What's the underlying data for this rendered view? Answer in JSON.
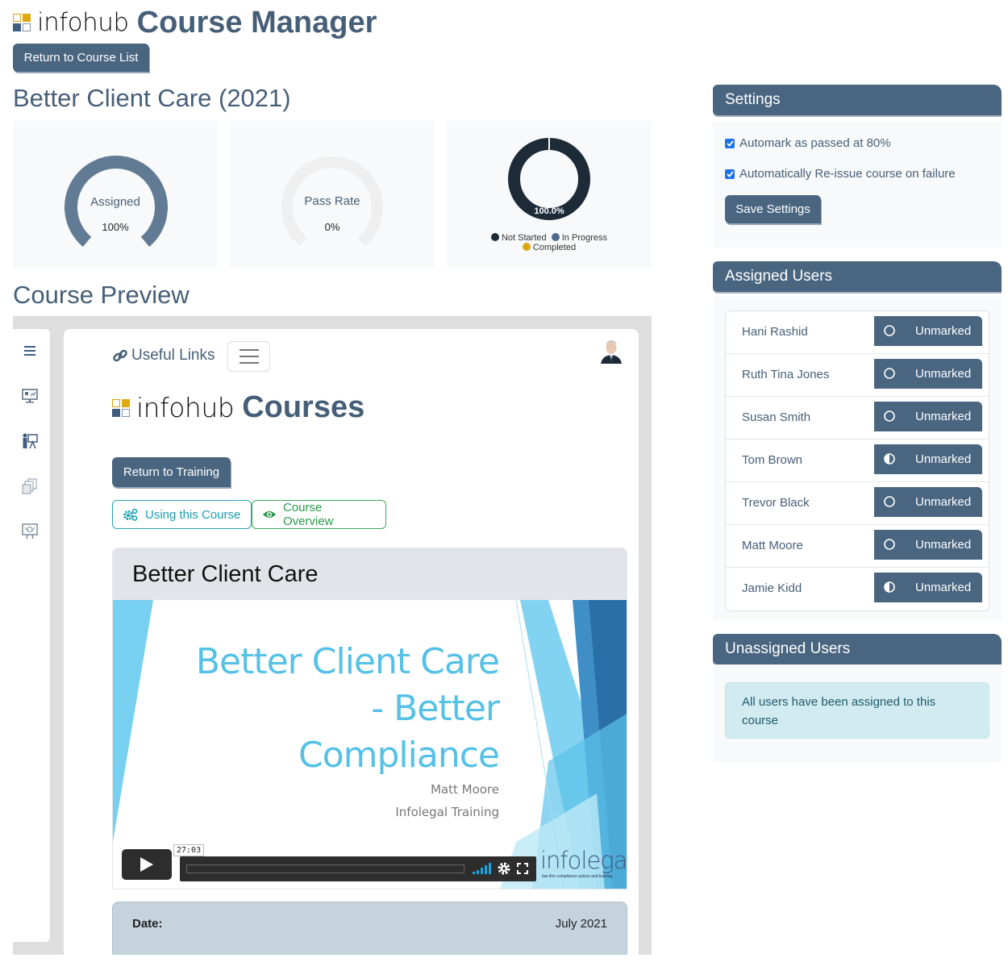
{
  "header": {
    "logo_text_light": "info",
    "logo_text_hub": "hub",
    "title": "Course Manager",
    "return_button": "Return to Course List"
  },
  "course": {
    "title": "Better Client Care (2021)"
  },
  "stats": {
    "assigned": {
      "label": "Assigned",
      "value": "100%",
      "fraction": 1.0,
      "color": "#627b94"
    },
    "pass_rate": {
      "label": "Pass Rate",
      "value": "0%",
      "fraction": 0.0,
      "track_color": "#efefef"
    }
  },
  "chart_data": {
    "type": "pie",
    "title": "",
    "donut": true,
    "categories": [
      "Not Started",
      "In Progress",
      "Completed"
    ],
    "values": [
      100.0,
      0.0,
      0.0
    ],
    "colors": [
      "#1d2a38",
      "#4d6b8a",
      "#dca90f"
    ],
    "data_labels": [
      "100.0%"
    ],
    "legend_position": "bottom"
  },
  "preview": {
    "heading": "Course Preview",
    "sidebar_icons": [
      "menu-icon",
      "dashboard-monitor-icon",
      "presenter-icon",
      "documents-icon",
      "presentation-board-icon"
    ],
    "useful_links": "Useful Links",
    "logo_text_light": "info",
    "logo_text_hub": "hub",
    "logo_title": "Courses",
    "return_training": "Return to Training",
    "using_course": "Using this Course",
    "course_overview": "Course Overview",
    "card_title": "Better Client Care",
    "slide": {
      "title_line1": "Better Client Care",
      "title_line2": "- Better",
      "title_line3": "Compliance",
      "author": "Matt Moore",
      "org": "Infolegal Training",
      "brand": "infolegal",
      "tagline": "law firm compliance advice and training"
    },
    "player": {
      "time": "27:03",
      "progress": 0.0
    },
    "date_label": "Date:",
    "date_value": "July 2021"
  },
  "settings": {
    "title": "Settings",
    "options": [
      {
        "label": "Automark as passed at 80%",
        "checked": true
      },
      {
        "label": "Automatically Re-issue course on failure",
        "checked": true
      }
    ],
    "save_button": "Save Settings"
  },
  "assigned_users": {
    "title": "Assigned Users",
    "users": [
      {
        "name": "Hani Rashid",
        "status": "Unmarked",
        "progress_icon": "empty-circle"
      },
      {
        "name": "Ruth Tina Jones",
        "status": "Unmarked",
        "progress_icon": "empty-circle"
      },
      {
        "name": "Susan Smith",
        "status": "Unmarked",
        "progress_icon": "empty-circle"
      },
      {
        "name": "Tom Brown",
        "status": "Unmarked",
        "progress_icon": "half-circle"
      },
      {
        "name": "Trevor Black",
        "status": "Unmarked",
        "progress_icon": "empty-circle"
      },
      {
        "name": "Matt Moore",
        "status": "Unmarked",
        "progress_icon": "empty-circle"
      },
      {
        "name": "Jamie Kidd",
        "status": "Unmarked",
        "progress_icon": "half-circle"
      }
    ]
  },
  "unassigned_users": {
    "title": "Unassigned Users",
    "message": "All users have been assigned to this course"
  }
}
